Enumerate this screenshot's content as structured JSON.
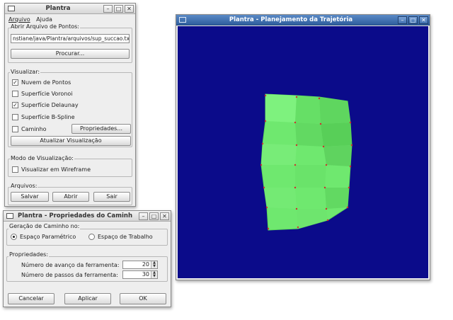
{
  "main_window": {
    "title": "Plantra",
    "controls": {
      "minimize": "–",
      "maximize": "□",
      "close": "✕"
    },
    "menu": [
      "Arquivo",
      "Ajuda"
    ],
    "open_group": {
      "label": "Abrir Arquivo de Pontos:",
      "path_value": "nstiane/java/Plantra/arquivos/sup_succao.txt",
      "browse_button": "Procurar..."
    },
    "view_group": {
      "label": "Visualizar:",
      "options": [
        {
          "label": "Nuvem de Pontos",
          "checked": true
        },
        {
          "label": "Superfície Voronoi",
          "checked": false
        },
        {
          "label": "Superfície Delaunay",
          "checked": true
        },
        {
          "label": "Superfície B-Spline",
          "checked": false
        },
        {
          "label": "Caminho",
          "checked": false
        }
      ],
      "properties_button": "Propriedades...",
      "update_button": "Atualizar Visualização"
    },
    "mode_group": {
      "label": "Modo de Visualização:",
      "wireframe": {
        "label": "Visualizar em Wireframe",
        "checked": false
      }
    },
    "files_group": {
      "label": "Arquivos:",
      "save_button": "Salvar",
      "open_button": "Abrir",
      "exit_button": "Sair"
    }
  },
  "props_window": {
    "title": "Plantra - Propriedades do Caminho",
    "controls": {
      "minimize": "–",
      "maximize": "□",
      "close": "✕"
    },
    "path_group": {
      "label": "Geração de Caminho no:",
      "options": [
        {
          "label": "Espaço Paramétrico",
          "selected": true
        },
        {
          "label": "Espaço de Trabalho",
          "selected": false
        }
      ]
    },
    "props_group": {
      "label": "Propriedades:",
      "fields": [
        {
          "label": "Número de avanço da ferramenta:",
          "value": "20"
        },
        {
          "label": "Número de passos da ferramenta:",
          "value": "30"
        }
      ]
    },
    "buttons": {
      "cancel": "Cancelar",
      "apply": "Aplicar",
      "ok": "OK"
    }
  },
  "viewer_window": {
    "title": "Plantra - Planejamento da Trajetória",
    "controls": {
      "minimize": "–",
      "maximize": "□",
      "close": "✕"
    },
    "colors": {
      "background": "#0b0b8a",
      "surface": "#6fe86f",
      "points": "#d03030"
    }
  }
}
